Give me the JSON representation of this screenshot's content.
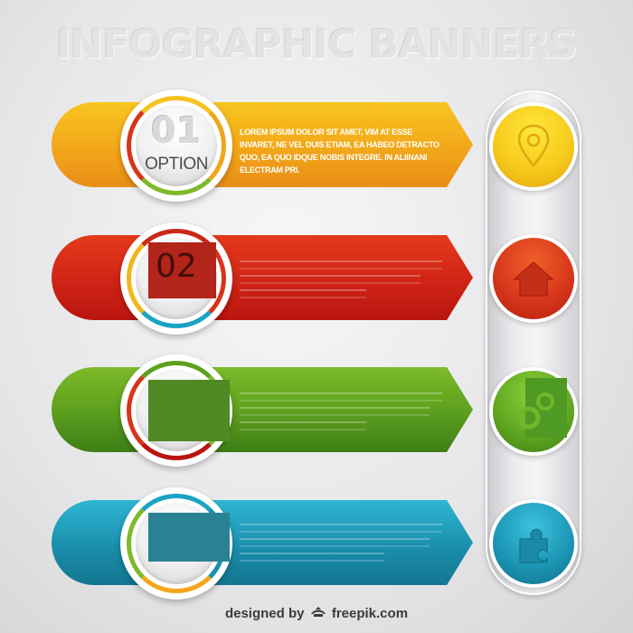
{
  "header": {
    "title": "INFOGRAPHIC BANNERS"
  },
  "banners": [
    {
      "number": "01",
      "label": "OPTION",
      "color": "#f2a71a",
      "text": "LOREM IPSUM DOLOR SIT AMET, VIM AT ESSE INVARET, NE VEL DUIS ETIAM, EA HABEO DETRACTO QUO, EA QUO IDQUE NOBIS INTEGRE. IN ALIINANI ELECTRAM PRI.",
      "icon": "location-pin-icon"
    },
    {
      "number": "02",
      "label": "",
      "color": "#cf2416",
      "text": "",
      "icon": "house-icon"
    },
    {
      "number": "",
      "label": "",
      "color": "#5ea11e",
      "text": "",
      "icon": "gears-icon"
    },
    {
      "number": "",
      "label": "",
      "color": "#1a8fad",
      "text": "",
      "icon": "puzzle-icon"
    }
  ],
  "footer": {
    "prefix": "designed by",
    "brand": "freepik.com"
  }
}
